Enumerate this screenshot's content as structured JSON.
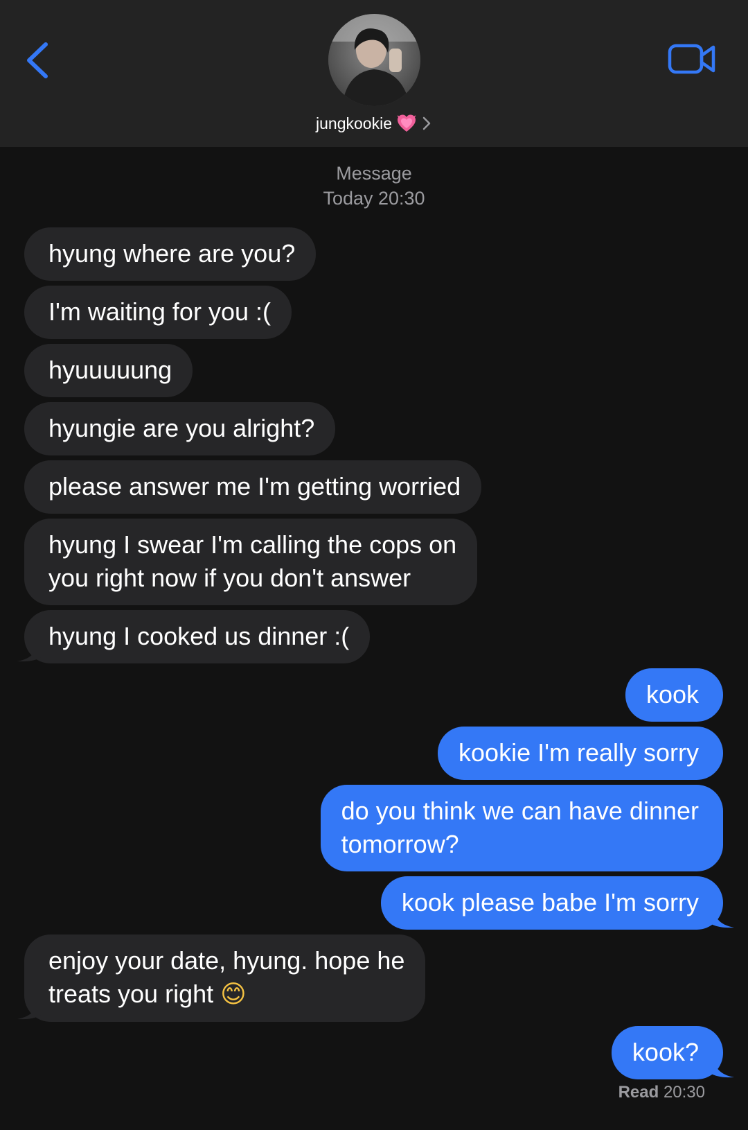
{
  "header": {
    "contact_name": "jungkookie",
    "back_icon": "chevron-left-icon",
    "video_icon": "video-camera-icon",
    "heart_icon": "growing-heart-emoji"
  },
  "thread": {
    "service_label": "Message",
    "date_label": "Today 20:30"
  },
  "messages": [
    {
      "direction": "incoming",
      "text": "hyung where are you?"
    },
    {
      "direction": "incoming",
      "text": "I'm waiting for you :("
    },
    {
      "direction": "incoming",
      "text": "hyuuuuung"
    },
    {
      "direction": "incoming",
      "text": "hyungie are you alright?"
    },
    {
      "direction": "incoming",
      "text": "please answer me I'm getting worried"
    },
    {
      "direction": "incoming",
      "line1": "hyung I swear I'm calling the cops on",
      "line2": "you right now if you don't answer"
    },
    {
      "direction": "incoming",
      "text": "hyung I cooked us dinner :("
    },
    {
      "direction": "outgoing",
      "text": "kook"
    },
    {
      "direction": "outgoing",
      "text": "kookie I'm really sorry"
    },
    {
      "direction": "outgoing",
      "line1": "do you think we can have dinner",
      "line2": "tomorrow?"
    },
    {
      "direction": "outgoing",
      "text": "kook please babe I'm sorry"
    },
    {
      "direction": "incoming",
      "line1": "enjoy your date, hyung. hope he",
      "line2": "treats you right",
      "emoji": "😊"
    },
    {
      "direction": "outgoing",
      "text": "kook?"
    }
  ],
  "receipt": {
    "status": "Read",
    "time": "20:30"
  },
  "colors": {
    "background": "#121212",
    "header": "#232323",
    "incoming_bubble": "#262628",
    "outgoing_bubble": "#3478f6",
    "accent": "#3478f6",
    "secondary_text": "#9b9b9f"
  }
}
